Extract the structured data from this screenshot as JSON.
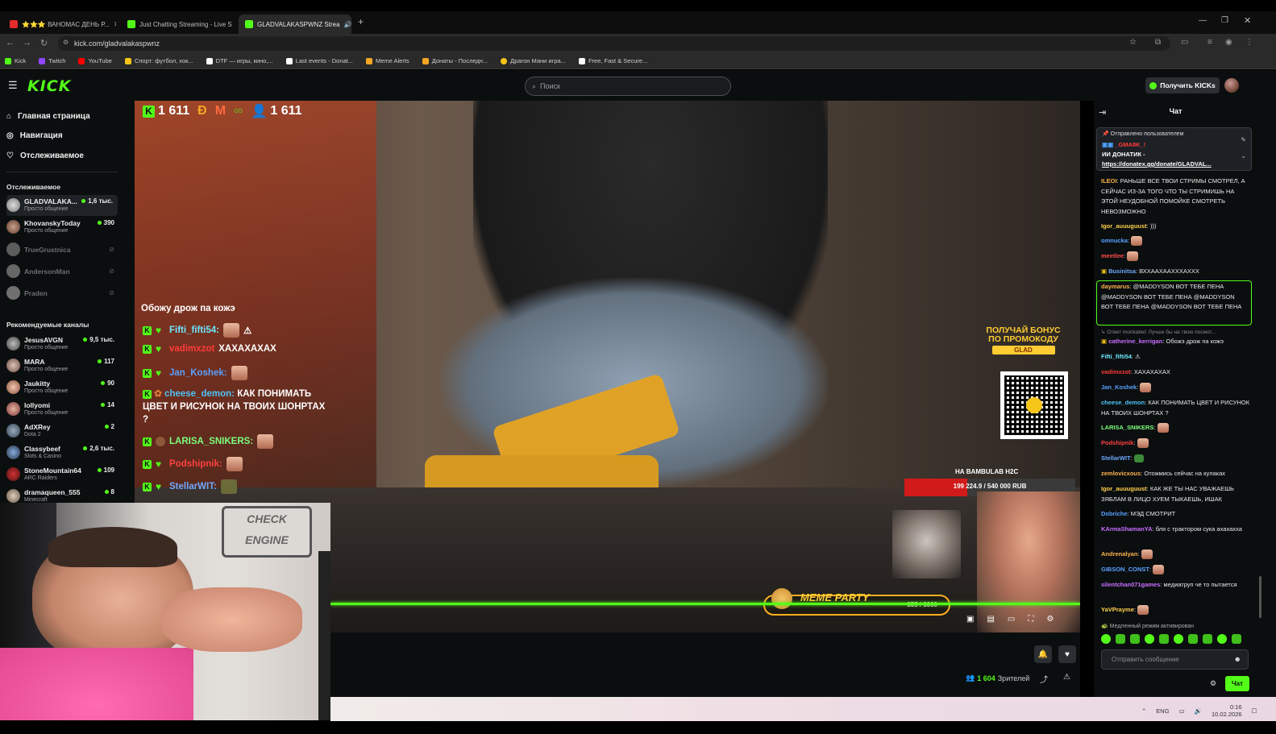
{
  "browser": {
    "tabs": [
      {
        "label": "⭐⭐⭐ ВАНОМАС ДЕНЬ Р...",
        "color": "#e32b2b"
      },
      {
        "label": "Just Chatting Streaming - Live S",
        "color": "#53fc18"
      },
      {
        "label": "GLADVALAKASPWNZ Strea",
        "color": "#53fc18"
      }
    ],
    "new_tab": "+",
    "url": "kick.com/gladvalakaspwnz",
    "bookmarks": [
      {
        "label": "Kick",
        "color": "#53fc18"
      },
      {
        "label": "Twitch",
        "color": "#9146ff"
      },
      {
        "label": "YouTube",
        "color": "#ff0000"
      },
      {
        "label": "Спорт: футбол, хок...",
        "color": "#f5c518"
      },
      {
        "label": "DTF — игры, кино,...",
        "color": "#ffffff"
      },
      {
        "label": "Last events - Donat...",
        "color": "#ffffff"
      },
      {
        "label": "Meme Alerts",
        "color": "#f5a623"
      },
      {
        "label": "Донаты - Последн...",
        "color": "#f5a623"
      },
      {
        "label": "Драгон Мани игра...",
        "color": "#f5c518"
      },
      {
        "label": "Free, Fast & Secure...",
        "color": "#ffffff"
      }
    ]
  },
  "kick": {
    "logo": "KICK",
    "search_placeholder": "Поиск",
    "get_kicks": "Получить KICKs"
  },
  "sidebar": {
    "nav": [
      "Главная страница",
      "Навигация",
      "Отслеживаемое"
    ],
    "followed_title": "Отслеживаемое",
    "followed": [
      {
        "name": "GLADVALAKA...",
        "category": "Просто общение",
        "viewers": "1,6 тыс.",
        "live": true
      },
      {
        "name": "KhovanskyToday",
        "category": "Просто общение",
        "viewers": "390",
        "live": true
      },
      {
        "name": "TrueGrustnica",
        "live": false
      },
      {
        "name": "AndersonMan",
        "live": false
      },
      {
        "name": "Praden",
        "live": false
      }
    ],
    "recommended_title": "Рекомендуемые каналы",
    "recommended": [
      {
        "name": "JesusAVGN",
        "category": "Просто общение",
        "viewers": "9,5 тыс."
      },
      {
        "name": "MARA",
        "category": "Просто общение",
        "viewers": "117"
      },
      {
        "name": "Jaukitty",
        "category": "Просто общение",
        "viewers": "90"
      },
      {
        "name": "lollyomi",
        "category": "Просто общение",
        "viewers": "14"
      },
      {
        "name": "AdXRey",
        "category": "Dota 2",
        "viewers": "2"
      },
      {
        "name": "Classybeef",
        "category": "Slots & Casino",
        "viewers": "2,6 тыс."
      },
      {
        "name": "StoneMountain64",
        "category": "ARC Raiders",
        "viewers": "109"
      },
      {
        "name": "dramaqueen_555",
        "category": "Minecraft",
        "viewers": "8"
      }
    ]
  },
  "video": {
    "stats": {
      "kick": "1 611",
      "viewers": "1 611"
    },
    "overlay_title": "Обожу дрож па кожэ",
    "overlay_chat": [
      {
        "user": "Fifti_fifti54:",
        "text": "",
        "color": "#6ee7ff"
      },
      {
        "user": "vadimxzot",
        "text": "ХАХАХАХАХ",
        "color": "#ff3b3b"
      },
      {
        "user": "Jan_Koshek:",
        "text": "",
        "color": "#5aa0ff"
      },
      {
        "user": "cheese_demon:",
        "text": "КАК ПОНИМАТЬ ЦВЕТ И РИСУНОК НА ТВОИХ ШОНРТАХ ?",
        "color": "#4fc3f7"
      },
      {
        "user": "LARISA_SNIKERS:",
        "text": "",
        "color": "#7cfc7c"
      },
      {
        "user": "Podshipnik:",
        "text": "",
        "color": "#ff4040"
      },
      {
        "user": "StellarWIT:",
        "text": "",
        "color": "#6fa8ff"
      }
    ],
    "promo": [
      "ПОЛУЧАЙ БОНУС",
      "ПО ПРОМОКОДУ",
      "GLAD"
    ],
    "goal_title": "НА BAMBULAB H2C",
    "goal_text": "199 224.9 / 540 000 RUB",
    "goal_progress": 0.369,
    "meme_party": "MEME PARTY",
    "meme_count": "355 / 3000",
    "bottom_stream_progress": 1.0
  },
  "below": {
    "viewers_count": "1 604",
    "viewers_label": "Зрителей"
  },
  "chat": {
    "title": "Чат",
    "pinned_label": "Отправлено пользователем",
    "pinned_user": "_GMA8K_!",
    "pinned_text": "ИИ ДОНАТИК -",
    "pinned_link": "https://donatex.gg/donate/GLADVAL...",
    "messages": [
      {
        "user": "ILEOI",
        "color": "#ffb24d",
        "text": "РАНЬШЕ ВСЕ ТВОИ СТРИМЫ СМОТРЕЛ, А СЕЙЧАС ИЗ-ЗА ТОГО ЧТО ТЫ СТРИМИШЬ НА ЭТОЙ НЕУДОБНОЙ ПОМОЙКЕ СМОТРЕТЬ НЕВОЗМОЖНО"
      },
      {
        "user": "Igor_auuuguust",
        "color": "#ffd24d",
        "text": ")))"
      },
      {
        "user": "omnucka",
        "color": "#5aa0ff",
        "text": ""
      },
      {
        "user": "meetlee",
        "color": "#ff4a4a",
        "text": ""
      },
      {
        "user": "Businitsa",
        "color": "#6fa8ff",
        "text": "ВХХААХААХХХАХХХ"
      },
      {
        "user": "daymarus",
        "color": "#ffb24d",
        "text": "@MADDYSON ВОТ ТЕБЕ ПЕНА @MADDYSON ВОТ ТЕБЕ ПЕНА @MADDYSON ВОТ ТЕБЕ ПЕНА @MADDYSON ВОТ ТЕБЕ ПЕНА"
      },
      {
        "user": "",
        "color": "#888",
        "text": "Ответ monkabel: Лучше бы на твою посмот..."
      },
      {
        "user": "catherine_kerrigan",
        "color": "#c86fff",
        "text": "Обожэ дрож па кожэ"
      },
      {
        "user": "Fifti_fifti54",
        "color": "#6ee7ff",
        "text": ""
      },
      {
        "user": "vadimxzot",
        "color": "#ff3b3b",
        "text": "ХАХАХАХАХ"
      },
      {
        "user": "Jan_Koshek",
        "color": "#5aa0ff",
        "text": ""
      },
      {
        "user": "cheese_demon",
        "color": "#4fc3f7",
        "text": "КАК ПОНИМАТЬ ЦВЕТ И РИСУНОК НА ТВОИХ ШОНРТАХ ?"
      },
      {
        "user": "LARISA_SNIKERS",
        "color": "#7cfc7c",
        "text": ""
      },
      {
        "user": "Podshipnik",
        "color": "#ff4040",
        "text": ""
      },
      {
        "user": "StellarWIT",
        "color": "#6fa8ff",
        "text": ""
      },
      {
        "user": "zemlovicxous",
        "color": "#ffb24d",
        "text": "Отожмись сейчас на кулаках"
      },
      {
        "user": "Igor_auuuguust",
        "color": "#ffd24d",
        "text": "КАК ЖЕ ТЫ НАС УВАЖАЕШЬ ЗЯБЛАМ В ЛИЦО ХУЕМ ТЫКАЕШЬ, ИШАК"
      },
      {
        "user": "Dobriche",
        "color": "#5aa0ff",
        "text": "МЭД СМОТРИТ"
      },
      {
        "user": "KArmaShamanYA",
        "color": "#c86fff",
        "text": "бля с трактором сука ахахахха"
      },
      {
        "user": "Andrenalyan",
        "color": "#ffb24d",
        "text": ""
      },
      {
        "user": "GIBSON_CONST",
        "color": "#5aa0ff",
        "text": ""
      },
      {
        "user": "silentchan071games",
        "color": "#c86fff",
        "text": "медиатруп че то пытается"
      },
      {
        "user": "YaVPrayme",
        "color": "#ffd24d",
        "text": ""
      }
    ],
    "slow_mode": "Медленный режим активирован",
    "input_placeholder": "Отправить сообщение",
    "send_label": "Чат"
  },
  "taskbar": {
    "lang": "ENG",
    "time": "0:16",
    "date": "10.02.2026"
  }
}
